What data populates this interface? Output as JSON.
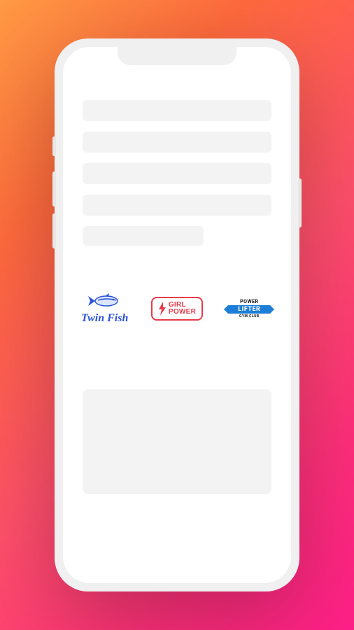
{
  "brands": [
    {
      "name": "Twin Fish",
      "label": "Twin Fish"
    },
    {
      "name": "Girl Power",
      "line1": "GIRL",
      "line2": "POWER"
    },
    {
      "name": "Power Lifter",
      "top": "POWER",
      "ribbon": "LIFTER",
      "sub": "GYM CLUB"
    }
  ]
}
